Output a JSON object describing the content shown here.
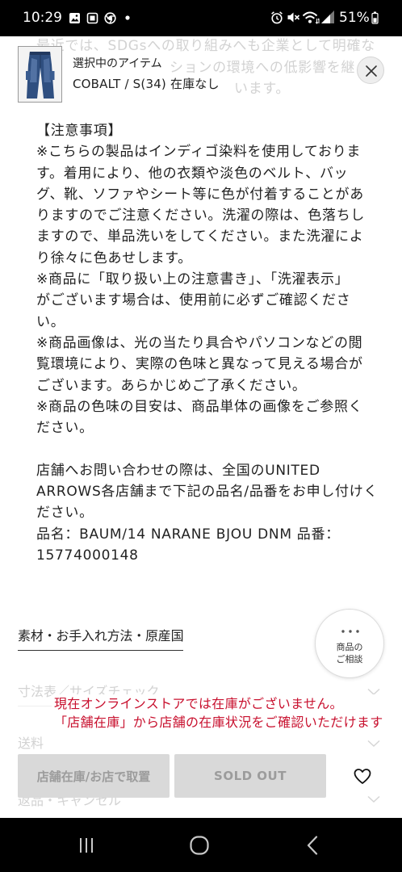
{
  "status_bar": {
    "time": "10:29",
    "battery": "51%",
    "icons": {
      "left": [
        "gallery-icon",
        "screenshot-icon",
        "chrome-icon",
        "notification-dot-icon"
      ],
      "right": [
        "alarm-icon",
        "mute-icon",
        "wifi-icon",
        "signal-icon",
        "battery-icon"
      ]
    }
  },
  "background_text": {
    "fragments": [
      "最近では、SDGsへの取り組みへも企業として明確な",
      "ションの環境への低影響を継",
      "います。"
    ]
  },
  "selected_item": {
    "label": "選択中のアイテム",
    "variant": "COBALT / S(34) 在庫なし",
    "thumbnail_icon": "jeans-thumbnail-image",
    "close_icon": "close-icon"
  },
  "notes": {
    "heading": "【注意事項】",
    "lines": [
      "※こちらの製品はインディゴ染料を使用しておりま",
      "す。着用により、他の衣類や淡色のベルト、バッ",
      "グ、靴、ソファやシート等に色が付着することがあ",
      "りますのでご注意ください。洗濯の際は、色落ちし",
      "ますので、単品洗いをしてください。また洗濯によ",
      "り徐々に色あせします。",
      "※商品に「取り扱い上の注意書き」、「洗濯表示」",
      "がございます場合は、使用前に必ずご確認くださ",
      "い。",
      "※商品画像は、光の当たり具合やパソコンなどの閲",
      "覧環境により、実際の色味と異なって見える場合が",
      "ございます。あらかじめご了承ください。",
      "※商品の色味の目安は、商品単体の画像をご参照く",
      "ださい。"
    ]
  },
  "contact": {
    "lines": [
      "店舗へお問い合わせの際は、全国のUNITED",
      "ARROWS各店舗まで下記の品名/品番をお申し付けく",
      "ださい。",
      "品名：BAUM/14 NARANE BJOU DNM 品番：",
      "15774000148"
    ]
  },
  "accordion": {
    "active_tab": "素材・お手入れ方法・原産国",
    "items": [
      {
        "label": "寸法表／サイズチェック",
        "icon": "chevron-down-icon"
      },
      {
        "label": "送料",
        "icon": "chevron-down-icon"
      },
      {
        "label": "返品・キャンセル",
        "icon": "chevron-down-icon"
      }
    ]
  },
  "consult_button": {
    "icon": "more-dots-icon",
    "line1": "商品の",
    "line2": "ご相談"
  },
  "stock_notice": {
    "lines": [
      "現在オンラインストアでは在庫がございません。",
      "「店舗在庫」から店舗の在庫状況をご確認いただけます"
    ]
  },
  "actions": {
    "store_stock_label": "店舗在庫/お店で取置",
    "sold_out_label": "SOLD OUT",
    "favorite_icon": "heart-icon"
  },
  "nav_bar": {
    "icons": [
      "recents-icon",
      "home-icon",
      "back-icon"
    ]
  },
  "colors": {
    "text": "#222222",
    "faded_text": "#d2d2d2",
    "notice_red": "#c8102e",
    "button_bg": "#d9d9d9",
    "button_text": "#9c9c9c",
    "system_bar_bg": "#000000"
  }
}
